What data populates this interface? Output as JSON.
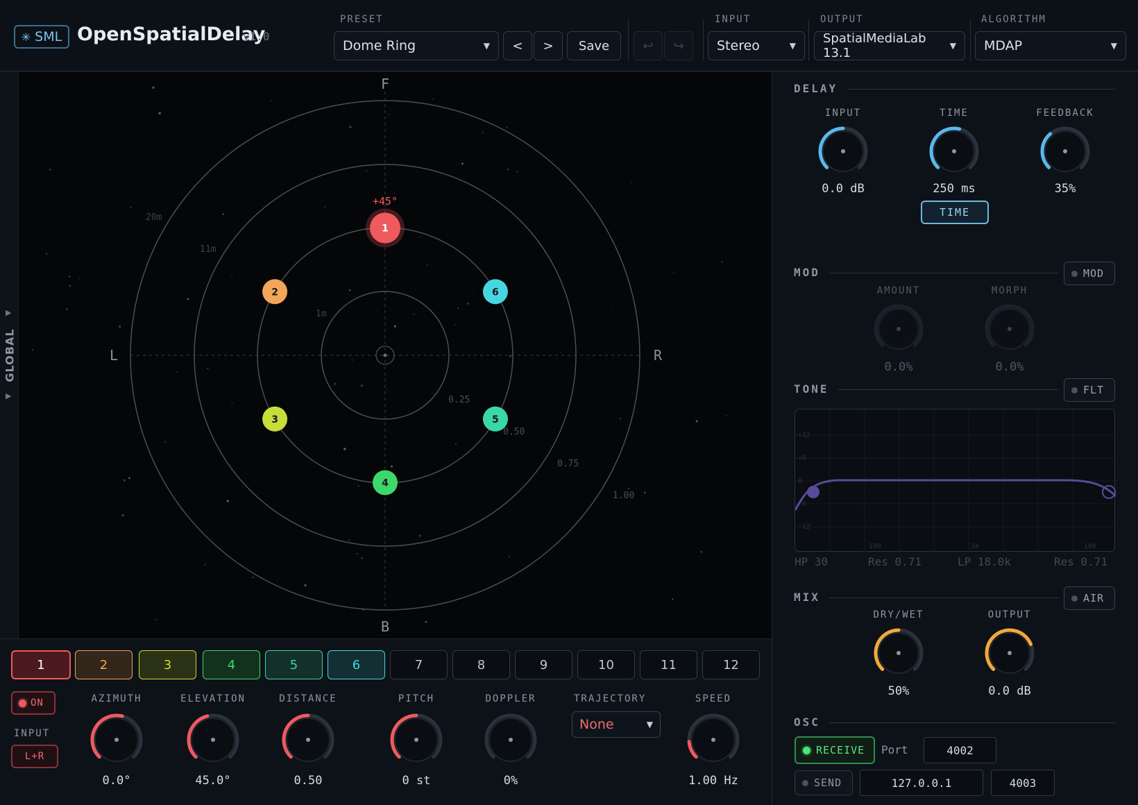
{
  "header": {
    "logo_text": "SML",
    "title": "OpenSpatialDelay",
    "version": "v1.0",
    "preset_label": "PRESET",
    "preset_value": "Dome Ring",
    "prev_label": "<",
    "next_label": ">",
    "save_label": "Save",
    "undo_icon": "↩",
    "redo_icon": "↪",
    "input_label": "INPUT",
    "input_value": "Stereo",
    "output_label": "OUTPUT",
    "output_value": "SpatialMediaLab 13.1",
    "algorithm_label": "ALGORITHM",
    "algorithm_value": "MDAP"
  },
  "sidebar": {
    "global_label": "GLOBAL"
  },
  "visualizer": {
    "front_label": "F",
    "back_label": "B",
    "left_label": "L",
    "right_label": "R",
    "elevation_readout": "+45°",
    "ring_labels": [
      "20m",
      "11m",
      "1m",
      "0.25",
      "0.50",
      "0.75",
      "1.00"
    ],
    "sources": [
      {
        "id": "1",
        "color": "#ef5a5e",
        "selected": true,
        "azimuth_deg": 0,
        "ring": 0.5
      },
      {
        "id": "2",
        "color": "#f2a65a",
        "azimuth_deg": -60,
        "ring": 0.5
      },
      {
        "id": "3",
        "color": "#c6dd3b",
        "azimuth_deg": -120,
        "ring": 0.5
      },
      {
        "id": "4",
        "color": "#3dd86a",
        "azimuth_deg": 180,
        "ring": 0.5
      },
      {
        "id": "5",
        "color": "#3ad7a8",
        "azimuth_deg": 120,
        "ring": 0.5
      },
      {
        "id": "6",
        "color": "#45d6e0",
        "azimuth_deg": 60,
        "ring": 0.5
      }
    ]
  },
  "delay": {
    "title": "DELAY",
    "knobs": [
      {
        "label": "INPUT",
        "value": "0.0 dB",
        "level": 0.5,
        "color": "#5ab8ec"
      },
      {
        "label": "TIME",
        "value": "250 ms",
        "level": 0.55,
        "color": "#5ab8ec"
      },
      {
        "label": "FEEDBACK",
        "value": "35%",
        "level": 0.35,
        "color": "#5ab8ec"
      }
    ],
    "time_button": "TIME"
  },
  "mod": {
    "title": "MOD",
    "toggle": "MOD",
    "knobs": [
      {
        "label": "AMOUNT",
        "value": "0.0%",
        "level": 0.0
      },
      {
        "label": "MORPH",
        "value": "0.0%",
        "level": 0.0
      }
    ]
  },
  "tone": {
    "title": "TONE",
    "toggle": "FLT",
    "db_ticks": [
      "+12",
      "+6",
      "0",
      "-6",
      "-12"
    ],
    "freq_ticks": [
      "100",
      "1k",
      "10k"
    ],
    "hp_label": "HP 30",
    "hp_res": "Res 0.71",
    "lp_label": "LP 18.0k",
    "lp_res": "Res 0.71"
  },
  "mix": {
    "title": "MIX",
    "toggle": "AIR",
    "knobs": [
      {
        "label": "DRY/WET",
        "value": "50%",
        "level": 0.5,
        "color": "#f2a83c"
      },
      {
        "label": "OUTPUT",
        "value": "0.0 dB",
        "level": 0.75,
        "color": "#f2a83c"
      }
    ]
  },
  "osc": {
    "title": "OSC",
    "receive_label": "RECEIVE",
    "port_label": "Port",
    "receive_port": "4002",
    "send_label": "SEND",
    "send_ip": "127.0.0.1",
    "send_port": "4003"
  },
  "channels": {
    "tabs": [
      {
        "label": "1",
        "color": "#ef5a5e"
      },
      {
        "label": "2",
        "color": "#f2a65a"
      },
      {
        "label": "3",
        "color": "#c6dd3b"
      },
      {
        "label": "4",
        "color": "#3dd86a"
      },
      {
        "label": "5",
        "color": "#3ad7a8"
      },
      {
        "label": "6",
        "color": "#45d6e0"
      },
      {
        "label": "7"
      },
      {
        "label": "8"
      },
      {
        "label": "9"
      },
      {
        "label": "10"
      },
      {
        "label": "11"
      },
      {
        "label": "12"
      }
    ],
    "on_label": "ON",
    "input_label": "INPUT",
    "input_value": "L+R",
    "knobs": [
      {
        "label": "AZIMUTH",
        "value": "0.0°",
        "level": 0.55,
        "color": "#ef5a5e"
      },
      {
        "label": "ELEVATION",
        "value": "45.0°",
        "level": 0.45,
        "color": "#ef5a5e"
      },
      {
        "label": "DISTANCE",
        "value": "0.50",
        "level": 0.5,
        "color": "#ef5a5e"
      },
      {
        "label": "PITCH",
        "value": "0 st",
        "level": 0.5,
        "color": "#ef5a5e"
      },
      {
        "label": "DOPPLER",
        "value": "0%",
        "level": 0.0,
        "color": "#ef5a5e"
      },
      {
        "label": "SPEED",
        "value": "1.00 Hz",
        "level": 0.15,
        "color": "#ef5a5e"
      }
    ],
    "trajectory_label": "TRAJECTORY",
    "trajectory_value": "None"
  }
}
